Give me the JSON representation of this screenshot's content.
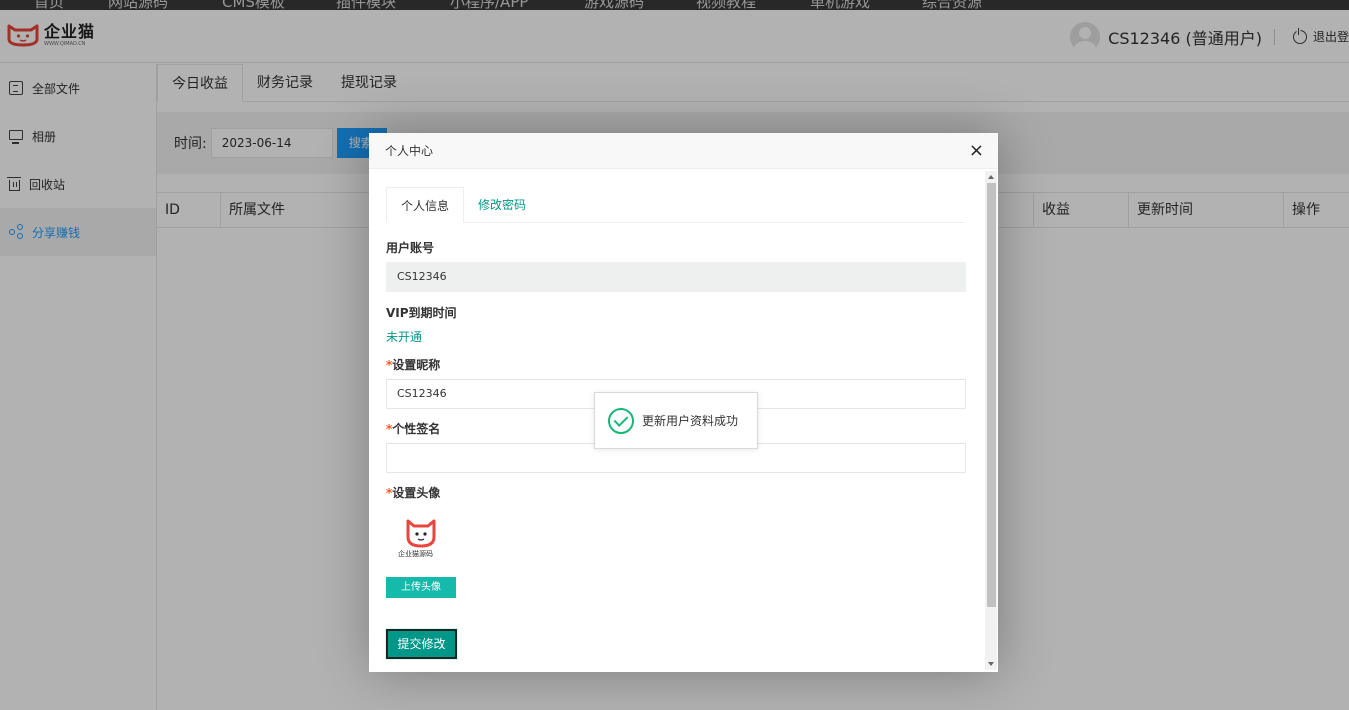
{
  "top_nav": [
    "首页",
    "网站源码",
    "CMS模板",
    "插件模块",
    "小程序/APP",
    "游戏源码",
    "视频教程",
    "单机游戏",
    "综合资源"
  ],
  "header": {
    "logo_text": "企业猫",
    "logo_subtext": "WWW.QIMAO.CN",
    "user_name": "CS12346 (普通用户)",
    "logout_label": "退出登"
  },
  "sidebar": {
    "items": [
      {
        "label": "全部文件",
        "icon": "file-icon"
      },
      {
        "label": "相册",
        "icon": "monitor-icon"
      },
      {
        "label": "回收站",
        "icon": "trash-icon"
      },
      {
        "label": "分享赚钱",
        "icon": "share-icon",
        "active": true
      }
    ]
  },
  "main": {
    "tabs": [
      "今日收益",
      "财务记录",
      "提现记录"
    ],
    "filter": {
      "label": "时间:",
      "date_value": "2023-06-14",
      "search_label": "搜索"
    },
    "table_headers": [
      "ID",
      "所属文件",
      "收益",
      "更新时间",
      "操作"
    ]
  },
  "modal": {
    "title": "个人中心",
    "close_glyph": "×",
    "tabs": [
      "个人信息",
      "修改密码"
    ],
    "account_label": "用户账号",
    "account_value": "CS12346",
    "vip_label": "VIP到期时间",
    "vip_value": "未开通",
    "required_mark": "*",
    "nickname_label": "设置昵称",
    "nickname_value": "CS12346",
    "signature_label": "个性签名",
    "signature_value": "",
    "avatar_label": "设置头像",
    "avatar_caption": "企业猫源码",
    "upload_label": "上传头像",
    "submit_label": "提交修改"
  },
  "toast": {
    "message": "更新用户资料成功",
    "icon": "check-circle-icon"
  },
  "colors": {
    "primary": "#1e9fff",
    "teal": "#009688",
    "upload": "#16baaa",
    "success": "#16b777",
    "required": "#ff5722",
    "logo_red": "#e8453c"
  }
}
